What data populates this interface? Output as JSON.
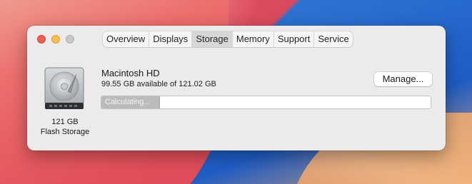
{
  "window": {
    "tabs": [
      {
        "label": "Overview",
        "active": false
      },
      {
        "label": "Displays",
        "active": false
      },
      {
        "label": "Storage",
        "active": true
      },
      {
        "label": "Memory",
        "active": false
      },
      {
        "label": "Support",
        "active": false
      },
      {
        "label": "Service",
        "active": false
      }
    ]
  },
  "drive": {
    "icon": "hard-drive-icon",
    "capacity": "121 GB",
    "type": "Flash Storage"
  },
  "volume": {
    "name": "Macintosh HD",
    "available": "99.55 GB available of 121.02 GB",
    "manage_label": "Manage...",
    "progress_label": "Calculating...",
    "progress_fraction": 0.175
  },
  "colors": {
    "close": "#ee5f57",
    "minimize": "#f6be4f",
    "zoom_disabled": "#c9c6c6",
    "active_tab": "#d9d6d6",
    "progress_fill": "#bdbaba"
  }
}
